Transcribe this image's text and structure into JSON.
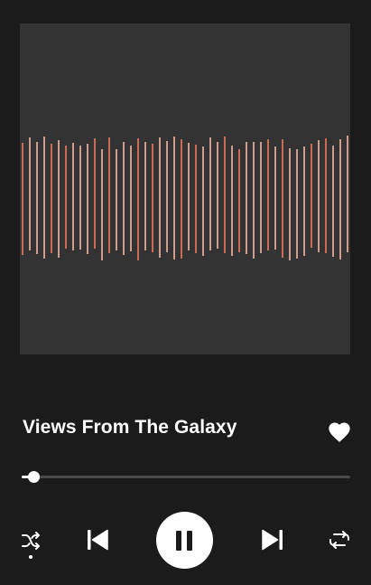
{
  "track": {
    "title": "Views From The Galaxy",
    "liked": true
  },
  "artwork": {
    "background": "#333333",
    "bar_colors": [
      "#f07a60",
      "#f6b6a4",
      "#ffffff"
    ]
  },
  "playback": {
    "progress": 0.02,
    "is_playing": true,
    "shuffle_on": true,
    "repeat_on": false
  },
  "icons": {
    "like": "heart-icon",
    "shuffle": "shuffle-icon",
    "previous": "skip-previous-icon",
    "pause": "pause-icon",
    "next": "skip-next-icon",
    "repeat": "repeat-icon"
  },
  "colors": {
    "background": "#1b1b1b",
    "foreground": "#ffffff",
    "track": "#4a4a4a"
  }
}
